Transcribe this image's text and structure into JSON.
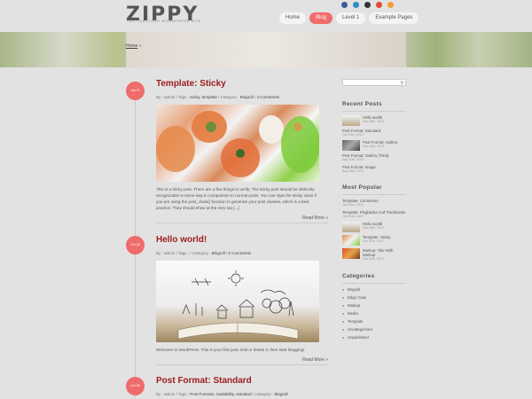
{
  "site": {
    "title": "ZIPPY",
    "tagline": "JUST ANOTHER WORDPRESS SITE"
  },
  "social": [
    {
      "name": "facebook-icon",
      "color": "#3b5998"
    },
    {
      "name": "twitter-icon",
      "color": "#2a90c8"
    },
    {
      "name": "pinterest-icon",
      "color": "#333333"
    },
    {
      "name": "googleplus-icon",
      "color": "#e14b2b"
    },
    {
      "name": "rss-icon",
      "color": "#f59c34"
    }
  ],
  "nav": [
    "Home",
    "Blog",
    "Level 1",
    "Example Pages"
  ],
  "breadcrumb": {
    "home": "Home",
    "sep": "»"
  },
  "posts": [
    {
      "date": "Jan 07",
      "title": "Template: Sticky",
      "meta": {
        "by": "By : admin",
        "tags_label": "Tags :",
        "tags": "sticky, template",
        "cat_label": "Category :",
        "cat": "Blogroll",
        "comments": "4 Comments"
      },
      "excerpt": "This is a sticky post. There are a few things to verify: The sticky post should be distinctly recognizable in some way in comparison to normal posts. You can style the sticky class if you are using the post_class() function to generate your post classes, which is a best practice. They should show at the very top [...]",
      "readmore": "Read More »"
    },
    {
      "date": "Oct 08",
      "title": "Hello world!",
      "meta": {
        "by": "By : admin",
        "tags_label": "Tags :",
        "tags": "",
        "cat_label": "Category :",
        "cat": "Blogroll",
        "comments": "5 Comments"
      },
      "excerpt": "Welcome to WordPress. This is your first post. Edit or delete it, then start blogging!",
      "readmore": "Read More »"
    },
    {
      "date": "Oct 05",
      "title": "Post Format: Standard",
      "meta": {
        "by": "By : admin",
        "tags_label": "Tags :",
        "tags": "Post Formats, readability, standard",
        "cat_label": "Category :",
        "cat": "Blogroll"
      }
    }
  ],
  "sidebar": {
    "search_icon": "search-icon",
    "recent_title": "Recent Posts",
    "recent": [
      {
        "title": "Hello world!",
        "date": "Sep 08th, 2013",
        "thumb": "sketch"
      },
      {
        "title": "Post Format: Standard",
        "date": "Oct 05th, 2013",
        "thumb": ""
      },
      {
        "title": "Post Format: Gallery",
        "date": "Sep 10th, 2013",
        "thumb": "gallery"
      },
      {
        "title": "Post Format: Gallery (Tiled)",
        "date": "Sep 10th, 2013",
        "thumb": ""
      },
      {
        "title": "Post Format: Image",
        "date": "Aug 08th, 2013",
        "thumb": ""
      }
    ],
    "popular_title": "Most Popular",
    "popular": [
      {
        "title": "Template: Comments",
        "date": "Jan 03rd, 2012",
        "thumb": ""
      },
      {
        "title": "Template: Pingbacks And Trackbacks",
        "date": "Jan 01st, 2012",
        "thumb": ""
      },
      {
        "title": "Hello world!",
        "date": "Sep 08th, 2013",
        "thumb": "sketch"
      },
      {
        "title": "Template: Sticky",
        "date": "Jan 07th, 2012",
        "thumb": "food"
      },
      {
        "title": "Markup: Title With Markup",
        "date": "Jan 05th, 2013",
        "thumb": "fruit"
      }
    ],
    "categories_title": "Categories",
    "categories": [
      "Blogroll",
      "Edge Case",
      "Markup",
      "Media",
      "Template",
      "Uncategorized",
      "Unpublished"
    ]
  },
  "colors": {
    "accent": "#f06b6b",
    "title": "#9c1c1c"
  }
}
